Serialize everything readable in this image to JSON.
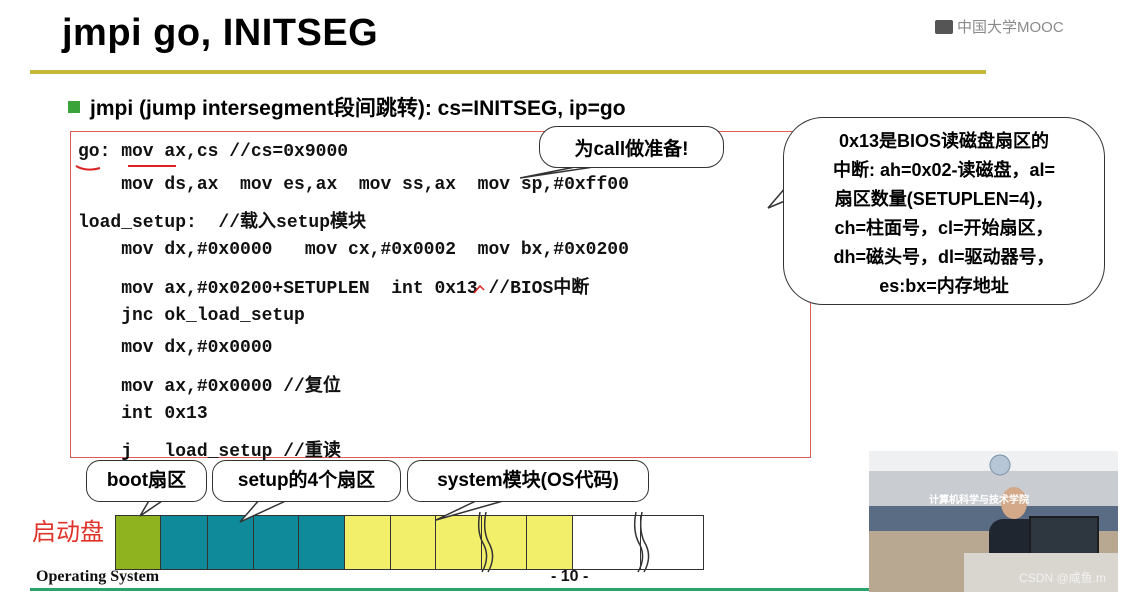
{
  "slide": {
    "title": "jmpi go, INITSEG",
    "logo_text": "中国大学MOOC",
    "bullet": "jmpi (jump intersegment段间跳转): cs=INITSEG, ip=go",
    "code_lines": [
      "go: mov ax,cs //cs=0x9000",
      "    mov ds,ax  mov es,ax  mov ss,ax  mov sp,#0xff00",
      "load_setup:  //载入setup模块",
      "    mov dx,#0x0000   mov cx,#0x0002  mov bx,#0x0200",
      "    mov ax,#0x0200+SETUPLEN  int 0x13 //BIOS中断",
      "    jnc ok_load_setup",
      "    mov dx,#0x0000",
      "    mov ax,#0x0000 //复位",
      "    int 0x13",
      "    j   load_setup //重读"
    ],
    "callout_call": "为call做准备!",
    "callout_bios": [
      "0x13是BIOS读磁盘扇区的",
      "中断: ah=0x02-读磁盘，al=",
      "扇区数量(SETUPLEN=4)，",
      "ch=柱面号，cl=开始扇区，",
      "dh=磁头号，dl=驱动器号，",
      "es:bx=内存地址"
    ],
    "disk_label": "启动盘",
    "label_boot": "boot扇区",
    "label_setup": "setup的4个扇区",
    "label_system": "system模块(OS代码)",
    "footer_left": "Operating System",
    "footer_page": "- 10 -"
  },
  "video": {
    "banner_text": "计算机科学与技术学院",
    "watermark": "CSDN @咸鱼.m"
  },
  "colors": {
    "title_rule": "#c5b73a",
    "bullet": "#3aa33a",
    "code_border": "#e05a5a",
    "boot_cell": "#8fb21f",
    "setup_cell": "#0f8a9a",
    "system_cell": "#f2f06a",
    "disk_label": "#e0332a",
    "footer_rule": "#2aa36a"
  }
}
